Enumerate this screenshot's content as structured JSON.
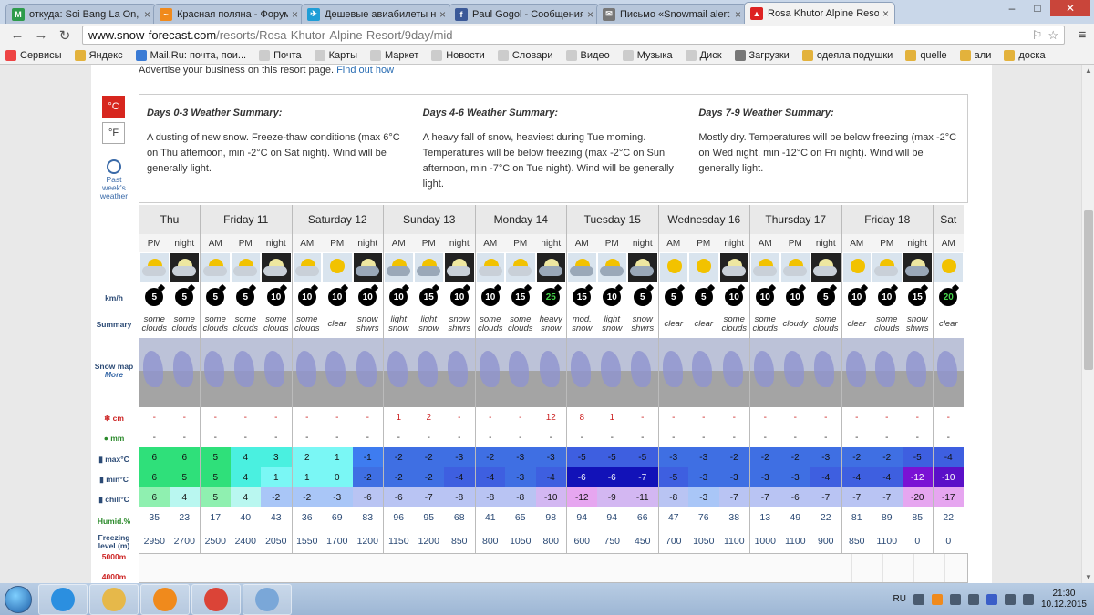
{
  "browser": {
    "tabs": [
      {
        "title": "откуда: Soi Bang La On, T",
        "color": "#2e9b4b",
        "glyph": "M"
      },
      {
        "title": "Красная поляна - Форум",
        "color": "#f08a1c",
        "glyph": "~"
      },
      {
        "title": "Дешевые авиабилеты на",
        "color": "#1f9dd6",
        "glyph": "✈"
      },
      {
        "title": "Paul Gogol - Сообщения",
        "color": "#3b5998",
        "glyph": "f"
      },
      {
        "title": "Письмо «Snowmail alert f",
        "color": "#777777",
        "glyph": "✉"
      },
      {
        "title": "Rosa Khutor Alpine Resort",
        "color": "#d22",
        "glyph": "▲",
        "active": true
      }
    ],
    "window_controls": [
      "–",
      "□",
      "✕"
    ],
    "url_host": "www.snow-forecast.com",
    "url_path": "/resorts/Rosa-Khutor-Alpine-Resort/9day/mid",
    "bookmarks": [
      "Сервисы",
      "Яндекс",
      "Mail.Ru: почта, пои...",
      "Почта",
      "Карты",
      "Маркет",
      "Новости",
      "Словари",
      "Видео",
      "Музыка",
      "Диск",
      "Загрузки",
      "одеяла подушки",
      "quelle",
      "али",
      "доска"
    ]
  },
  "page": {
    "advert": "Advertise your business on this resort page.",
    "advert_link": "Find out how",
    "unit_c": "°C",
    "unit_f": "°F",
    "past_week": "Past week's weather",
    "summaries": [
      {
        "title": "Days 0-3 Weather Summary:",
        "text": "A dusting of new snow. Freeze-thaw conditions (max 6°C on Thu afternoon, min -2°C on Sat night). Wind will be generally light."
      },
      {
        "title": "Days 4-6 Weather Summary:",
        "text": "A heavy fall of snow, heaviest during Tue morning. Temperatures will be below freezing (max -2°C on Sun afternoon, min -7°C on Tue night). Wind will be generally light."
      },
      {
        "title": "Days 7-9 Weather Summary:",
        "text": "Mostly dry. Temperatures will be below freezing (max -2°C on Wed night, min -12°C on Fri night). Wind will be generally light."
      }
    ],
    "row_labels": {
      "kmh": "km/h",
      "summary": "Summary",
      "snowmap": "Snow map",
      "more": "More",
      "cm": "cm",
      "mm": "mm",
      "max": "max°C",
      "min": "min°C",
      "chill": "chill°C",
      "humid": "Humid.%",
      "freezing": "Freezing level (m)",
      "l5000": "5000m",
      "l4000": "4000m"
    },
    "days": [
      {
        "name": "Thu",
        "cols": 2
      },
      {
        "name": "Friday 11",
        "cols": 3
      },
      {
        "name": "Saturday 12",
        "cols": 3
      },
      {
        "name": "Sunday 13",
        "cols": 3
      },
      {
        "name": "Monday 14",
        "cols": 3
      },
      {
        "name": "Tuesday 15",
        "cols": 3
      },
      {
        "name": "Wednesday 16",
        "cols": 3
      },
      {
        "name": "Thursday 17",
        "cols": 3
      },
      {
        "name": "Friday 18",
        "cols": 3
      },
      {
        "name": "Sat",
        "cols": 1
      }
    ],
    "periods": [
      "PM",
      "night",
      "AM",
      "PM",
      "night",
      "AM",
      "PM",
      "night",
      "AM",
      "PM",
      "night",
      "AM",
      "PM",
      "night",
      "AM",
      "PM",
      "night",
      "AM",
      "PM",
      "night",
      "AM",
      "PM",
      "night",
      "AM",
      "PM",
      "night",
      "AM"
    ],
    "icons": [
      "partly-cloudy",
      "partly-cloudy-night",
      "partly-cloudy",
      "partly-cloudy",
      "partly-cloudy-night",
      "partly-cloudy",
      "sun",
      "snow-night",
      "light-snow",
      "light-snow",
      "partly-cloudy-night",
      "partly-cloudy",
      "partly-cloudy",
      "heavy-snow-night",
      "snow",
      "light-snow",
      "snow-night",
      "sun",
      "sun",
      "partly-cloudy-night",
      "partly-cloudy",
      "cloudy",
      "partly-cloudy-night",
      "sun",
      "partly-cloudy",
      "snow-night",
      "sun"
    ],
    "wind": [
      "5",
      "5",
      "5",
      "5",
      "10",
      "10",
      "10",
      "10",
      "10",
      "15",
      "10",
      "10",
      "15",
      "25",
      "15",
      "10",
      "5",
      "5",
      "5",
      "10",
      "10",
      "10",
      "5",
      "10",
      "10",
      "15",
      "20"
    ],
    "summary": [
      "some clouds",
      "some clouds",
      "some clouds",
      "some clouds",
      "some clouds",
      "some clouds",
      "clear",
      "snow shwrs",
      "light snow",
      "light snow",
      "snow shwrs",
      "some clouds",
      "some clouds",
      "heavy snow",
      "mod. snow",
      "light snow",
      "snow shwrs",
      "clear",
      "clear",
      "some clouds",
      "some clouds",
      "cloudy",
      "some clouds",
      "clear",
      "some clouds",
      "snow shwrs",
      "clear"
    ],
    "snow_cm": [
      "-",
      "-",
      "-",
      "-",
      "-",
      "-",
      "-",
      "-",
      "1",
      "2",
      "-",
      "-",
      "-",
      "12",
      "8",
      "1",
      "-",
      "-",
      "-",
      "-",
      "-",
      "-",
      "-",
      "-",
      "-",
      "-",
      "-"
    ],
    "rain_mm": [
      "-",
      "-",
      "-",
      "-",
      "-",
      "-",
      "-",
      "-",
      "-",
      "-",
      "-",
      "-",
      "-",
      "-",
      "-",
      "-",
      "-",
      "-",
      "-",
      "-",
      "-",
      "-",
      "-",
      "-",
      "-",
      "-",
      "-"
    ],
    "max_c": [
      "6",
      "6",
      "5",
      "4",
      "3",
      "2",
      "1",
      "-1",
      "-2",
      "-2",
      "-3",
      "-2",
      "-3",
      "-3",
      "-5",
      "-5",
      "-5",
      "-3",
      "-3",
      "-2",
      "-2",
      "-2",
      "-3",
      "-2",
      "-2",
      "-5",
      "-4"
    ],
    "min_c": [
      "6",
      "5",
      "5",
      "4",
      "1",
      "1",
      "0",
      "-2",
      "-2",
      "-2",
      "-4",
      "-4",
      "-3",
      "-4",
      "-6",
      "-6",
      "-7",
      "-5",
      "-3",
      "-3",
      "-3",
      "-3",
      "-4",
      "-4",
      "-4",
      "-12",
      "-10"
    ],
    "chill_c": [
      "6",
      "4",
      "5",
      "4",
      "-2",
      "-2",
      "-3",
      "-6",
      "-6",
      "-7",
      "-8",
      "-8",
      "-8",
      "-10",
      "-12",
      "-9",
      "-11",
      "-8",
      "-3",
      "-7",
      "-7",
      "-6",
      "-7",
      "-7",
      "-7",
      "-20",
      "-17"
    ],
    "humid": [
      "35",
      "23",
      "17",
      "40",
      "43",
      "36",
      "69",
      "83",
      "96",
      "95",
      "68",
      "41",
      "65",
      "98",
      "94",
      "94",
      "66",
      "47",
      "76",
      "38",
      "13",
      "49",
      "22",
      "81",
      "89",
      "85",
      "22"
    ],
    "freezing": [
      "2950",
      "2700",
      "2500",
      "2400",
      "2050",
      "1550",
      "1700",
      "1200",
      "1150",
      "1200",
      "850",
      "800",
      "1050",
      "800",
      "600",
      "750",
      "450",
      "700",
      "1050",
      "1100",
      "1000",
      "1100",
      "900",
      "850",
      "1100",
      "0",
      "0"
    ]
  },
  "taskbar": {
    "lang": "RU",
    "time": "21:30",
    "date": "10.12.2015",
    "apps": [
      {
        "name": "ie",
        "color": "#2b8fe0"
      },
      {
        "name": "explorer",
        "color": "#e6b84a"
      },
      {
        "name": "media-player",
        "color": "#f08a1c"
      },
      {
        "name": "chrome",
        "color": "#db4437"
      },
      {
        "name": "paint",
        "color": "#7aa7d8"
      }
    ]
  }
}
